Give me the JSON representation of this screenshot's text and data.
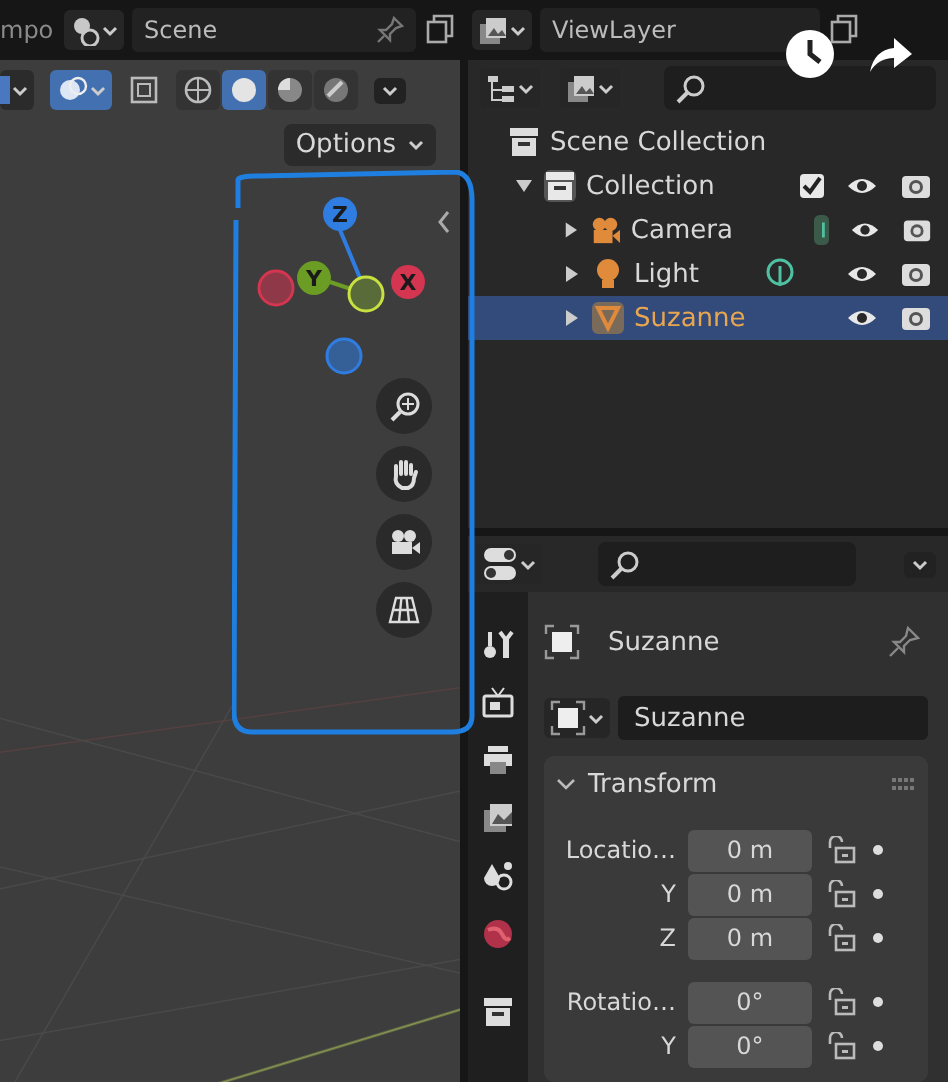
{
  "top_bar": {
    "workspace_tab": "mpo",
    "scene": "Scene",
    "view_layer": "ViewLayer"
  },
  "viewport": {
    "overlays_on": true,
    "options_label": "Options",
    "shading_modes": [
      {
        "kind": "wireframe",
        "selected": false
      },
      {
        "kind": "solid",
        "selected": true
      },
      {
        "kind": "material",
        "selected": false
      },
      {
        "kind": "rendered",
        "selected": false
      }
    ],
    "gizmo_axes": [
      {
        "label": "Z",
        "color": "#2f7de1"
      },
      {
        "label": "Y",
        "color": "#6b9c24"
      },
      {
        "label": "X",
        "color": "#d43550"
      }
    ]
  },
  "outliner": {
    "items": [
      {
        "label": "Scene Collection",
        "kind": "scene",
        "children": [
          {
            "label": "Collection",
            "kind": "collection",
            "expanded": true,
            "checked": true,
            "selected": false,
            "children": [
              {
                "label": "Camera",
                "kind": "camera",
                "expanded": false,
                "selected": false
              },
              {
                "label": "Light",
                "kind": "light",
                "expanded": false,
                "selected": false
              },
              {
                "label": "Suzanne",
                "kind": "mesh",
                "expanded": false,
                "selected": true
              }
            ]
          }
        ]
      }
    ]
  },
  "properties": {
    "object_name": "Suzanne",
    "data_name": "Suzanne",
    "panel": {
      "title": "Transform",
      "expanded": true,
      "groups": [
        {
          "rows": [
            {
              "label": "Locatio…",
              "value": "0 m"
            },
            {
              "label": "Y",
              "value": "0 m"
            },
            {
              "label": "Z",
              "value": "0 m"
            }
          ]
        },
        {
          "rows": [
            {
              "label": "Rotatio…",
              "value": "0°"
            },
            {
              "label": "Y",
              "value": "0°"
            }
          ]
        }
      ]
    }
  }
}
